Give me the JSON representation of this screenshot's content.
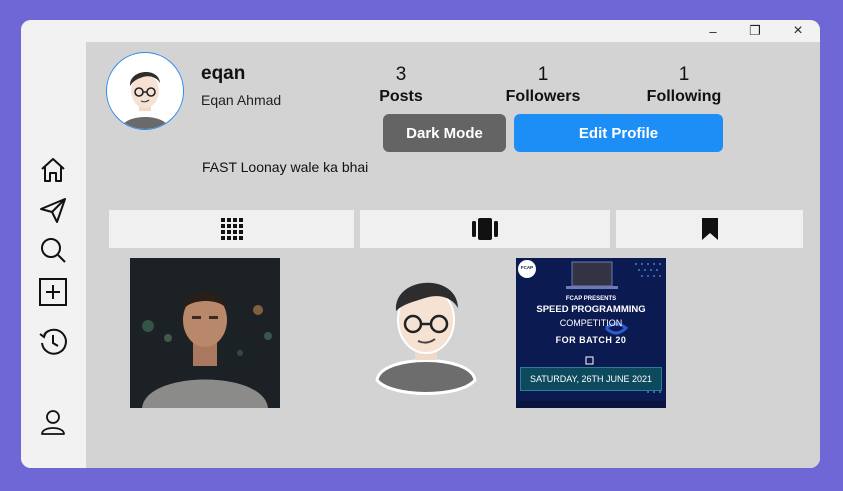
{
  "window": {
    "minimize": "–",
    "maximize": "❐",
    "close": "×"
  },
  "sidebar": {
    "items": [
      {
        "name": "home",
        "icon": "home-icon"
      },
      {
        "name": "messages",
        "icon": "paper-plane-icon"
      },
      {
        "name": "search",
        "icon": "search-icon"
      },
      {
        "name": "new-post",
        "icon": "plus-square-icon"
      },
      {
        "name": "history",
        "icon": "history-icon"
      },
      {
        "name": "profile",
        "icon": "user-icon"
      }
    ]
  },
  "profile": {
    "username": "eqan",
    "full_name": "Eqan Ahmad",
    "bio": "FAST Loonay wale ka bhai",
    "stats": [
      {
        "value": "3",
        "label": "Posts"
      },
      {
        "value": "1",
        "label": "Followers"
      },
      {
        "value": "1",
        "label": "Following"
      }
    ],
    "dark_mode_label": "Dark Mode",
    "edit_profile_label": "Edit Profile"
  },
  "tabs": [
    {
      "name": "grid",
      "icon": "grid-icon"
    },
    {
      "name": "reels",
      "icon": "carousel-icon"
    },
    {
      "name": "saved",
      "icon": "bookmark-icon"
    }
  ],
  "posts": {
    "poster": {
      "badge": "FCAP",
      "presents": "FCAP PRESENTS",
      "title": "SPEED PROGRAMMING",
      "subtitle": "COMPETITION",
      "batch": "FOR BATCH 20",
      "date": "SATURDAY, 26TH JUNE 2021"
    }
  },
  "colors": {
    "accent": "#1e8ef7",
    "frame": "#6f67d6",
    "content_bg": "#d3d3d3"
  }
}
